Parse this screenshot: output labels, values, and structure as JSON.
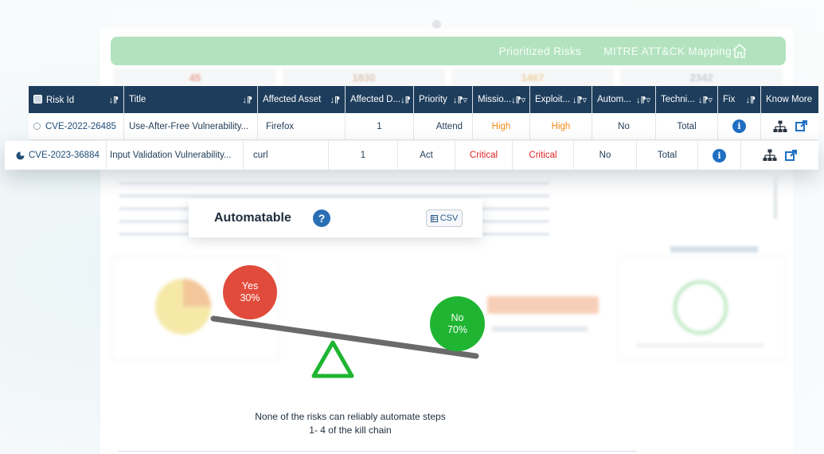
{
  "nav": {
    "links": [
      "Prioritized Risks",
      "MITRE ATT&CK Mapping"
    ],
    "home_icon": "home-icon"
  },
  "stats": [
    "45",
    "1830",
    "1467",
    "2342"
  ],
  "table": {
    "columns": [
      {
        "label": "Risk Id",
        "sort": "↓⁋"
      },
      {
        "label": "Title",
        "sort": "↓⁋"
      },
      {
        "label": "Affected Asset",
        "sort": "↓⁋"
      },
      {
        "label": "Affected D...",
        "sort": "↓⁋"
      },
      {
        "label": "Priority",
        "sort": "↓⁋▿"
      },
      {
        "label": "Missio...",
        "sort": "↓⁋▿"
      },
      {
        "label": "Exploit...",
        "sort": "↓⁋▿"
      },
      {
        "label": "Autom...",
        "sort": "↓⁋▿"
      },
      {
        "label": "Techni...",
        "sort": "↓⁋▿"
      },
      {
        "label": "Fix",
        "sort": "↓⁋"
      },
      {
        "label": "Know More",
        "sort": ""
      }
    ],
    "rows": [
      {
        "risk_id": "CVE-2022-26485",
        "title": "Use-After-Free Vulnerability...",
        "asset": "Firefox",
        "affected": "1",
        "priority": "Attend",
        "mission": "High",
        "exploit": "High",
        "automatable": "No",
        "technical": "Total"
      },
      {
        "risk_id": "CVE-2023-36884",
        "title": "Input Validation Vulnerability...",
        "asset": "curl",
        "affected": "1",
        "priority": "Act",
        "mission": "Critical",
        "exploit": "Critical",
        "automatable": "No",
        "technical": "Total"
      }
    ]
  },
  "automatable_card": {
    "title": "Automatable",
    "help": "?",
    "csv_label": "CSV"
  },
  "scale": {
    "yes_label": "Yes",
    "yes_value": "30%",
    "no_label": "No",
    "no_value": "70%"
  },
  "caption": {
    "line1": "None of the risks can reliably automate steps",
    "line2": "1- 4 of the kill chain"
  },
  "colors": {
    "header": "#1e3d5c",
    "navbar": "#b3e2bf",
    "yes": "#e14b3b",
    "no": "#1fb532",
    "high": "#f08a17",
    "critical": "#e02424",
    "fulcrum": "#1fb532"
  }
}
